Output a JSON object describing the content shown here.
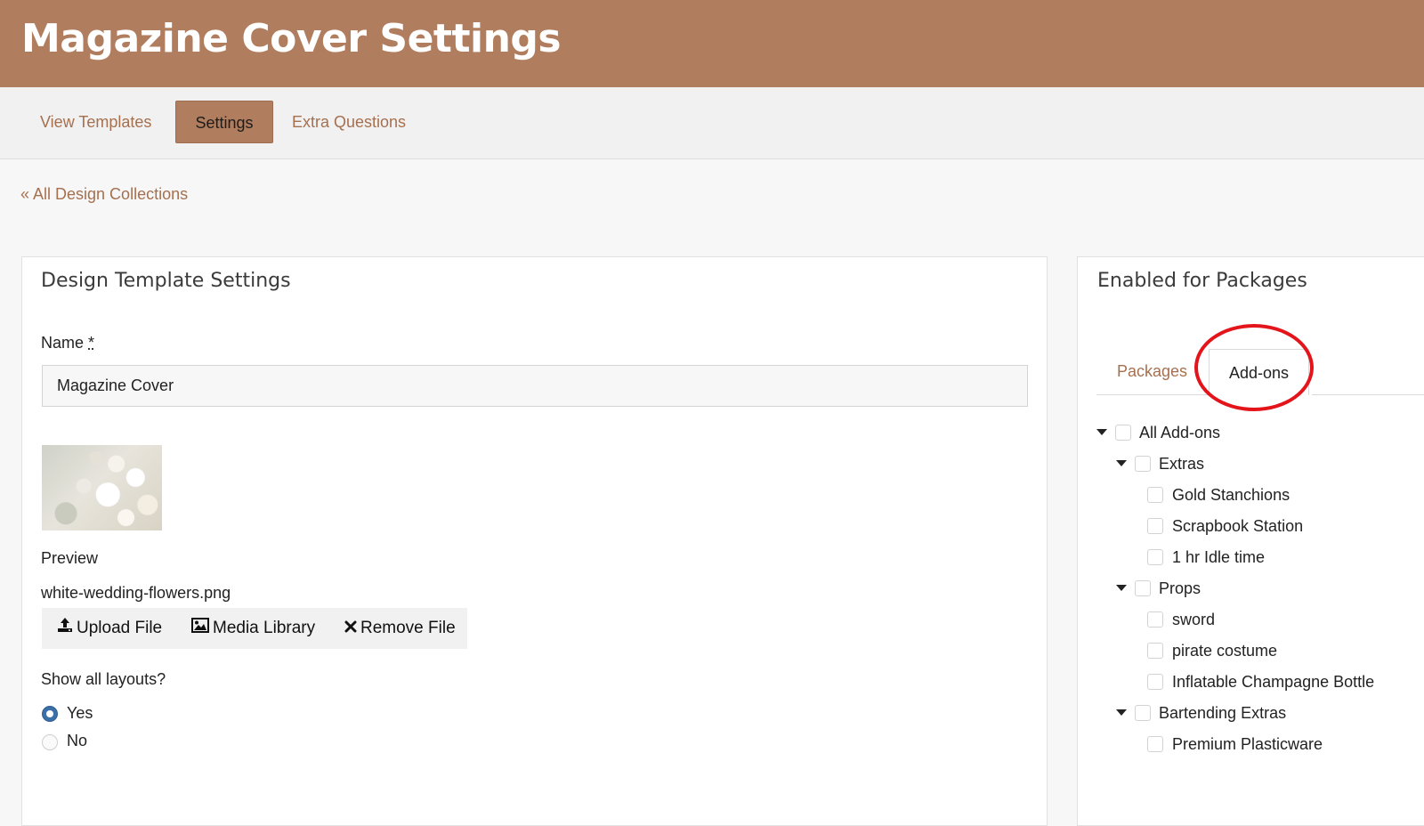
{
  "header": {
    "title": "Magazine Cover Settings"
  },
  "tabs": [
    {
      "label": "View Templates",
      "active": false
    },
    {
      "label": "Settings",
      "active": true
    },
    {
      "label": "Extra Questions",
      "active": false
    }
  ],
  "breadcrumb": "« All Design Collections",
  "design_panel": {
    "title": "Design Template Settings",
    "name_label": "Name",
    "required_mark": "*",
    "name_value": "Magazine Cover",
    "preview_label": "Preview",
    "file_name": "white-wedding-flowers.png",
    "buttons": {
      "upload": "Upload File",
      "media": "Media Library",
      "remove": "Remove File"
    },
    "layouts_question": "Show all layouts?",
    "options": [
      {
        "label": "Yes",
        "selected": true
      },
      {
        "label": "No",
        "selected": false
      }
    ]
  },
  "packages_panel": {
    "title": "Enabled for Packages",
    "tabs": [
      {
        "label": "Packages",
        "active": false
      },
      {
        "label": "Add-ons",
        "active": true
      }
    ],
    "tree": [
      {
        "label": "All Add-ons",
        "level": 0,
        "expandable": true,
        "checked": false
      },
      {
        "label": "Extras",
        "level": 1,
        "expandable": true,
        "checked": false
      },
      {
        "label": "Gold Stanchions",
        "level": 2,
        "expandable": false,
        "checked": false
      },
      {
        "label": "Scrapbook Station",
        "level": 2,
        "expandable": false,
        "checked": false
      },
      {
        "label": "1 hr Idle time",
        "level": 2,
        "expandable": false,
        "checked": false
      },
      {
        "label": "Props",
        "level": 1,
        "expandable": true,
        "checked": false
      },
      {
        "label": "sword",
        "level": 2,
        "expandable": false,
        "checked": false
      },
      {
        "label": "pirate costume",
        "level": 2,
        "expandable": false,
        "checked": false
      },
      {
        "label": "Inflatable Champagne Bottle",
        "level": 2,
        "expandable": false,
        "checked": false
      },
      {
        "label": "Bartending Extras",
        "level": 1,
        "expandable": true,
        "checked": false
      },
      {
        "label": "Premium Plasticware",
        "level": 2,
        "expandable": false,
        "checked": false
      }
    ]
  },
  "colors": {
    "brand": "#b07d5e",
    "link": "#a5704f",
    "annotation": "#e4141b",
    "radio_selected": "#3a6fa8"
  }
}
